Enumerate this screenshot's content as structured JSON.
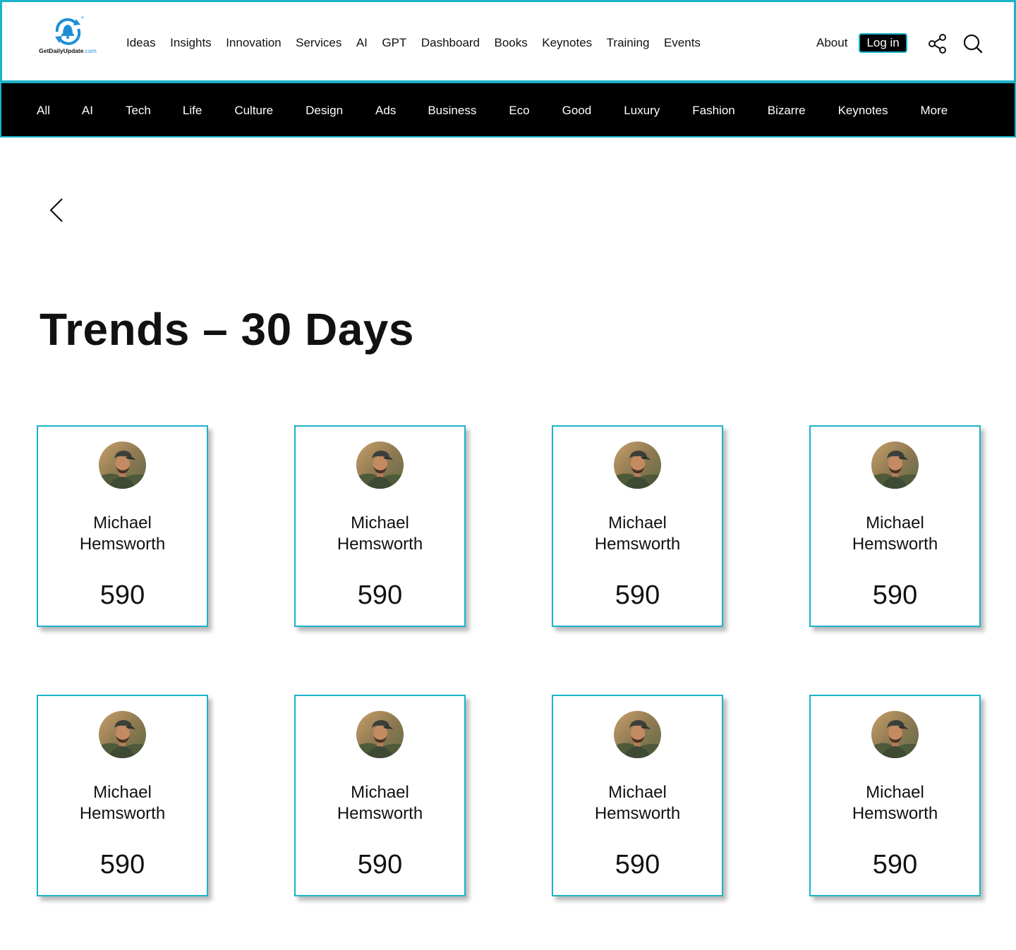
{
  "header": {
    "logo": {
      "name": "GetDailyUpdate",
      "suffix": ".com"
    },
    "nav": [
      "Ideas",
      "Insights",
      "Innovation",
      "Services",
      "AI",
      "GPT",
      "Dashboard",
      "Books",
      "Keynotes",
      "Training",
      "Events"
    ],
    "about_label": "About",
    "login_label": "Log in",
    "icons": {
      "share": "share-icon",
      "search": "search-icon"
    }
  },
  "categories": [
    "All",
    "AI",
    "Tech",
    "Life",
    "Culture",
    "Design",
    "Ads",
    "Business",
    "Eco",
    "Good",
    "Luxury",
    "Fashion",
    "Bizarre",
    "Keynotes",
    "More"
  ],
  "page": {
    "title": "Trends – 30 Days",
    "back_icon": "chevron-left-icon"
  },
  "cards": [
    {
      "name": "Michael Hemsworth",
      "count": "590"
    },
    {
      "name": "Michael Hemsworth",
      "count": "590"
    },
    {
      "name": "Michael Hemsworth",
      "count": "590"
    },
    {
      "name": "Michael Hemsworth",
      "count": "590"
    },
    {
      "name": "Michael Hemsworth",
      "count": "590"
    },
    {
      "name": "Michael Hemsworth",
      "count": "590"
    },
    {
      "name": "Michael Hemsworth",
      "count": "590"
    },
    {
      "name": "Michael Hemsworth",
      "count": "590"
    }
  ],
  "colors": {
    "accent": "#1bb3c9",
    "bar": "#000000",
    "logo_blue": "#1e8fd6"
  }
}
